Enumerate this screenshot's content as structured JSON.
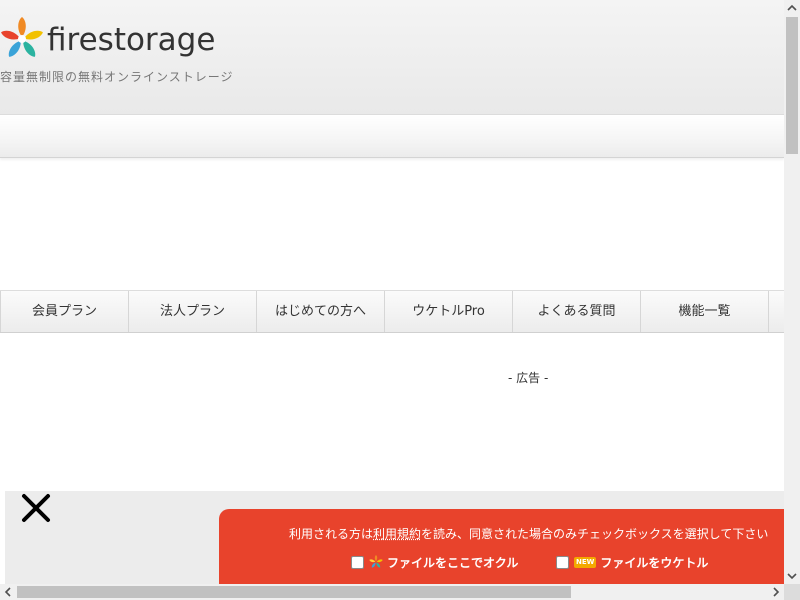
{
  "header": {
    "logo_text": "firestorage",
    "tagline": "容量無制限の無料オンラインストレージ"
  },
  "nav": {
    "items": [
      {
        "label": "会員プラン"
      },
      {
        "label": "法人プラン"
      },
      {
        "label": "はじめての方へ"
      },
      {
        "label": "ウケトルPro"
      },
      {
        "label": "よくある質問"
      },
      {
        "label": "機能一覧"
      }
    ]
  },
  "ad": {
    "label": "- 広告 -"
  },
  "upload_panel": {
    "agreement_prefix": "利用される方は",
    "terms_link": "利用規約",
    "agreement_suffix": "を読み、同意された場合のみチェックボックスを選択して下さい",
    "send_label": "ファイルをここでオクル",
    "receive_label": "ファイルをウケトル",
    "new_badge": "NEW",
    "send_checked": false,
    "receive_checked": false
  },
  "colors": {
    "panel_bg": "#e8432c",
    "header_bg": "#efefef",
    "overlay_bg": "#ececec"
  }
}
